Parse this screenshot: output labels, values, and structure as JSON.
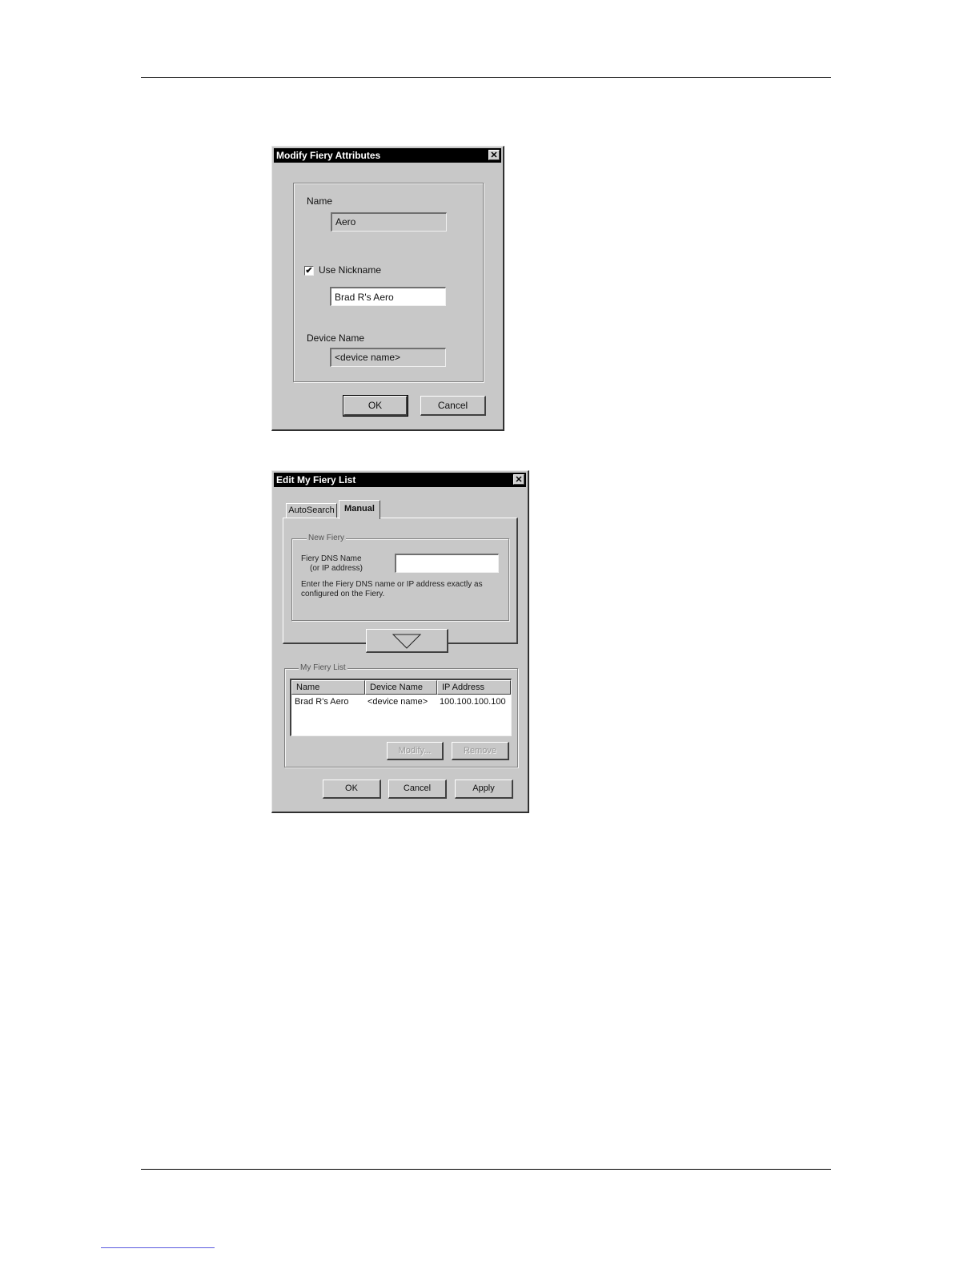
{
  "dialog1": {
    "title": "Modify Fiery Attributes",
    "close_glyph": "✕",
    "name_label": "Name",
    "name_value": "Aero",
    "use_nickname_label": "Use Nickname",
    "use_nickname_checked": true,
    "check_glyph": "✔",
    "nickname_value": "Brad R's Aero",
    "device_name_label": "Device Name",
    "device_name_value": "<device name>",
    "ok_label": "OK",
    "cancel_label": "Cancel"
  },
  "dialog2": {
    "title": "Edit My Fiery List",
    "close_glyph": "✕",
    "tabs": [
      {
        "label": "AutoSearch",
        "active": false
      },
      {
        "label": "Manual",
        "active": true
      }
    ],
    "new_fiery": {
      "legend": "New Fiery",
      "dns_label_line1": "Fiery DNS Name",
      "dns_label_line2": "(or IP address)",
      "dns_value": "",
      "help_line1": "Enter the Fiery DNS name or IP address exactly as",
      "help_line2": "configured on the Fiery."
    },
    "add_arrow_icon": "down-arrow-icon",
    "my_list": {
      "legend": "My Fiery List",
      "columns": [
        "Name",
        "Device Name",
        "IP Address"
      ],
      "rows": [
        [
          "Brad R's Aero",
          "<device name>",
          "100.100.100.100"
        ]
      ],
      "modify_label": "Modify...",
      "remove_label": "Remove"
    },
    "ok_label": "OK",
    "cancel_label": "Cancel",
    "apply_label": "Apply"
  }
}
